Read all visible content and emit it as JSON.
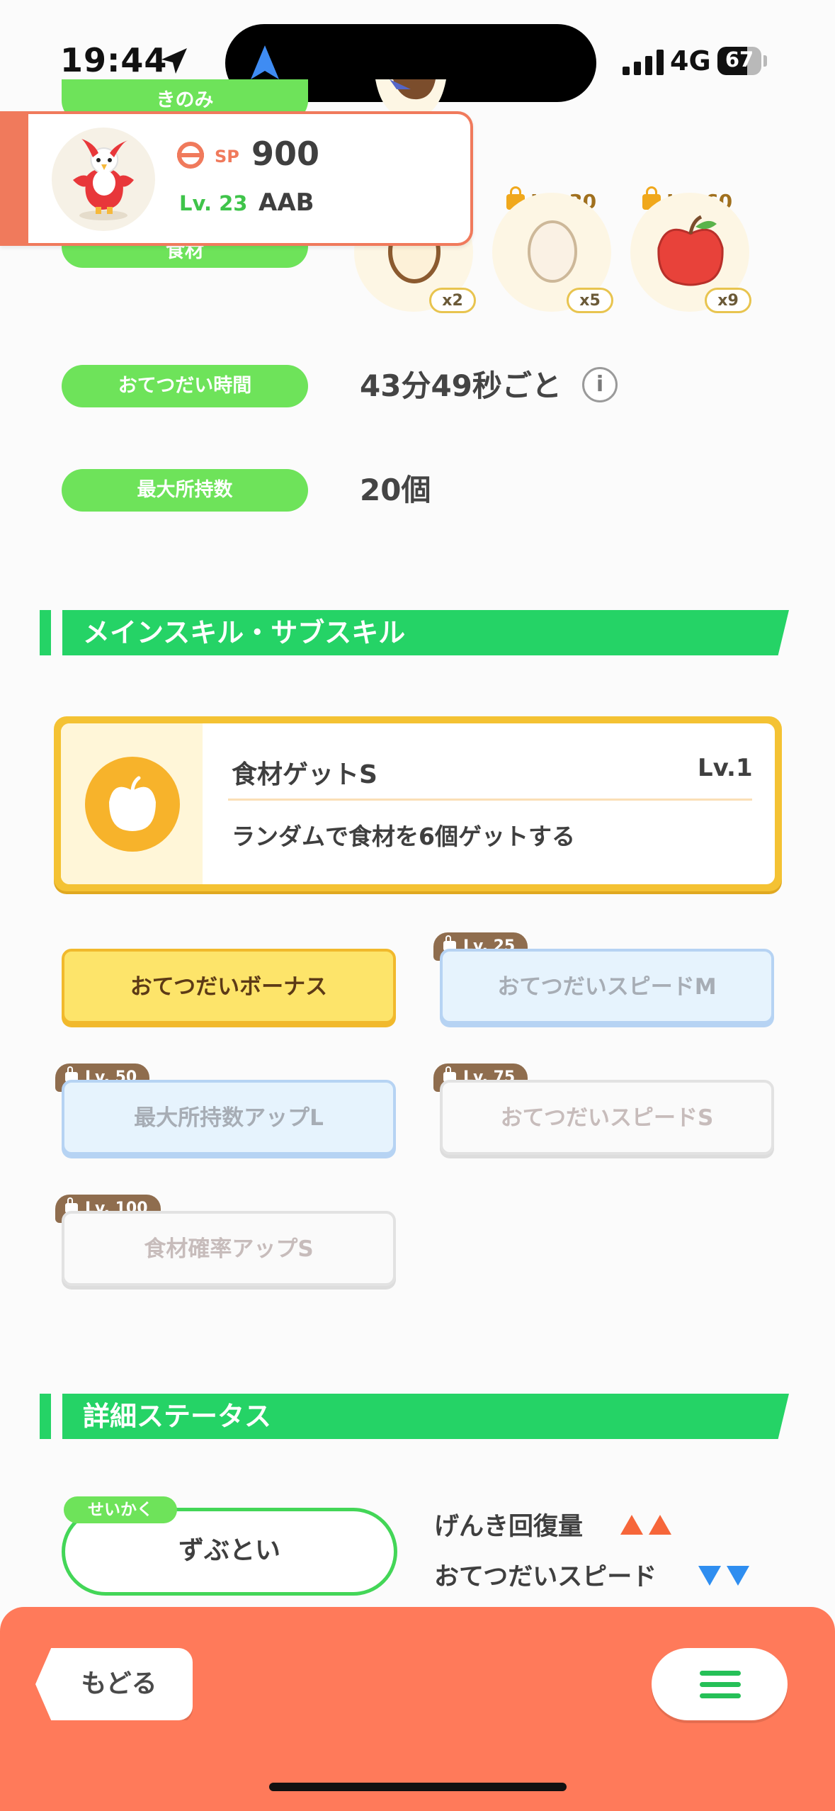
{
  "status_bar": {
    "time": "19:44",
    "network": "4G",
    "battery": "67",
    "battery_level": 0.67
  },
  "info": {
    "berry_label": "きのみ",
    "ingredient_label": "食材",
    "help_time_label": "おてつだい時間",
    "help_time_value": "43分49秒ごと",
    "max_carry_label": "最大所持数",
    "max_carry_value": "20個"
  },
  "ingredients": [
    {
      "qty": "x2",
      "lock_label": ""
    },
    {
      "qty": "x5",
      "lock_label": "Lv. 30"
    },
    {
      "qty": "x9",
      "lock_label": "Lv. 60"
    }
  ],
  "pokemon_card": {
    "sp_label": "SP",
    "sp_value": "900",
    "level": "Lv. 23",
    "subskill_code": "AAB"
  },
  "main_skill_section": {
    "title": "メインスキル・サブスキル",
    "skill_name": "食材ゲットS",
    "skill_level": "Lv.1",
    "skill_desc": "ランダムで食材を6個ゲットする",
    "icon": "apple-icon"
  },
  "sub_skills": [
    {
      "label": "おてつだいボーナス",
      "lock": ""
    },
    {
      "label": "おてつだいスピードM",
      "lock": "Lv. 25"
    },
    {
      "label": "最大所持数アップL",
      "lock": "Lv. 50"
    },
    {
      "label": "おてつだいスピードS",
      "lock": "Lv. 75"
    },
    {
      "label": "食材確率アップS",
      "lock": "Lv. 100"
    }
  ],
  "detail_section": {
    "title": "詳細ステータス",
    "nature_tag": "せいかく",
    "nature_value": "ずぶとい",
    "up_effect": "げんき回復量",
    "down_effect": "おてつだいスピード",
    "up_color": "#f6663a",
    "down_color": "#2f8ef0"
  },
  "bottom_bar": {
    "back_label": "もどる",
    "menu_icon": "hamburger-icon",
    "color": "#ff7a5a"
  }
}
